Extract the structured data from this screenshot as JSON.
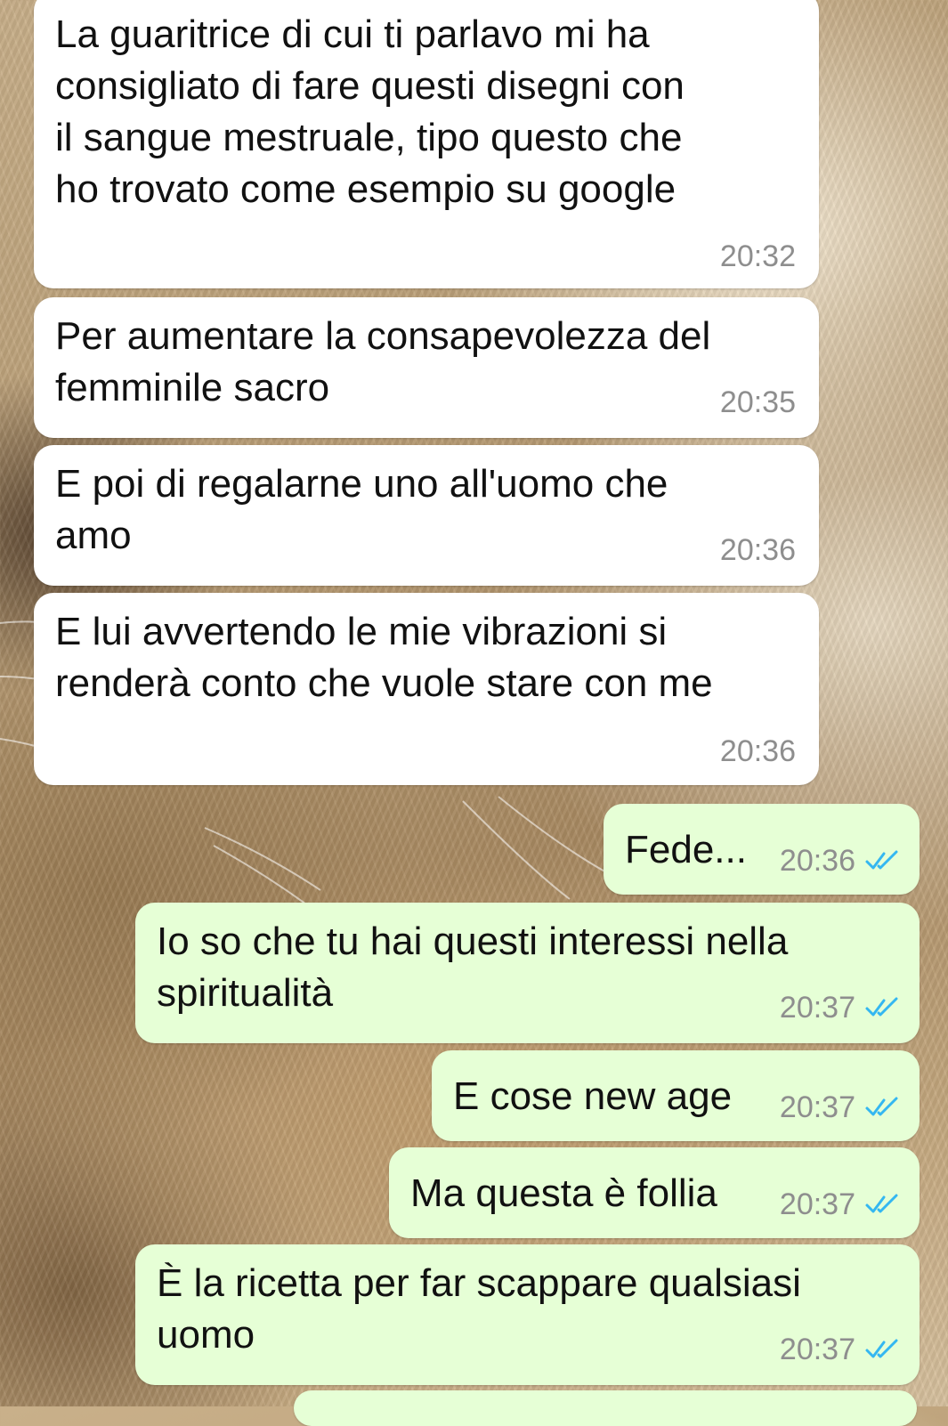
{
  "messages": [
    {
      "direction": "incoming",
      "text": "La guaritrice di cui ti parlavo mi ha\nconsigliato di fare questi disegni con\nil sangue mestruale, tipo questo che\nho trovato come esempio su google",
      "time": "20:32"
    },
    {
      "direction": "incoming",
      "text": "Per aumentare la consapevolezza del\nfemminile sacro",
      "time": "20:35"
    },
    {
      "direction": "incoming",
      "text": "E poi di regalarne uno all'uomo che\namo",
      "time": "20:36"
    },
    {
      "direction": "incoming",
      "text": "E lui avvertendo le mie vibrazioni si\nrenderà conto che vuole stare con me",
      "time": "20:36"
    },
    {
      "direction": "outgoing",
      "text": "Fede...",
      "time": "20:36",
      "status": "read"
    },
    {
      "direction": "outgoing",
      "text": "Io so che tu hai questi interessi nella\nspiritualità",
      "time": "20:37",
      "status": "read"
    },
    {
      "direction": "outgoing",
      "text": "E cose new age",
      "time": "20:37",
      "status": "read"
    },
    {
      "direction": "outgoing",
      "text": "Ma questa è follia",
      "time": "20:37",
      "status": "read"
    },
    {
      "direction": "outgoing",
      "text": "È la ricetta per far scappare qualsiasi\nuomo",
      "time": "20:37",
      "status": "read"
    }
  ],
  "colors": {
    "incoming_bubble": "#ffffff",
    "outgoing_bubble": "#e6ffd6",
    "timestamp": "#8e8e8e",
    "read_ticks": "#34b7f1"
  },
  "icons": {
    "read_status": "double-check-icon"
  }
}
